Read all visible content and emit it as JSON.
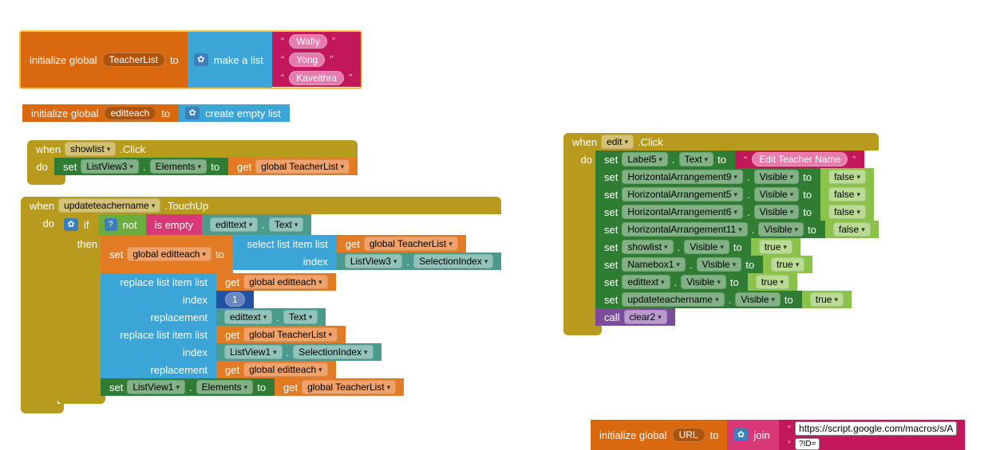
{
  "init_global": {
    "label": "initialize global",
    "var1": "TeacherList",
    "to": "to",
    "make_list": "make a list",
    "item1": "Wafiy",
    "item2": "Yong",
    "item3": "Kaveithra",
    "var2": "editteach",
    "create_empty": "create empty list",
    "var3": "URL",
    "join": "join",
    "url_val": "https://script.google.com/macros/s/A",
    "idq": "?ID="
  },
  "when1": {
    "when": "when",
    "comp": "showlist",
    "event": ".Click",
    "do": "do",
    "set": "set",
    "lv": "ListView3",
    "elems": "Elements",
    "to": "to",
    "get": "get",
    "gtl": "global TeacherList"
  },
  "when2": {
    "when": "when",
    "comp": "updateteachername",
    "event": ".TouchUp",
    "do": "do",
    "if": "if",
    "not": "not",
    "isempty": "is empty",
    "edittext": "edittext",
    "text": "Text",
    "then": "then",
    "set": "set",
    "ge": "global editteach",
    "to": "to",
    "select": "select list item  list",
    "get": "get",
    "gtl": "global TeacherList",
    "index": "index",
    "lv3": "ListView3",
    "seli": "SelectionIndex",
    "repl": "replace list item  list",
    "one": "1",
    "replacement": "replacement",
    "lv1": "ListView1",
    "elems": "Elements"
  },
  "when3": {
    "when": "when",
    "comp": "edit",
    "event": ".Click",
    "do": "do",
    "set": "set",
    "label5": "Label5",
    "text": "Text",
    "to": "to",
    "edit_tn": "Edit Teacher Name",
    "visible": "Visible",
    "false": "false",
    "true": "true",
    "ha9": "HorizontalArrangement9",
    "ha5": "HorizontalArrangement5",
    "ha6": "HorizontalArrangement6",
    "ha11": "HorizontalArrangement11",
    "showlist": "showlist",
    "namebox1": "Namebox1",
    "edittext": "edittext",
    "utn": "updateteachername",
    "call": "call",
    "clear2": "clear2"
  }
}
